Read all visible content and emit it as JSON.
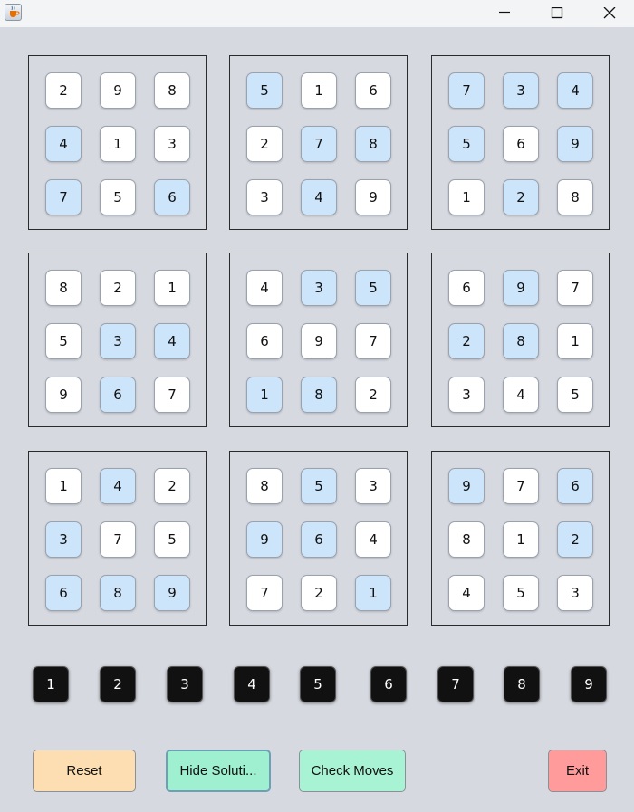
{
  "window": {
    "app_icon": "java-cup-icon",
    "controls": [
      "minimize-icon",
      "maximize-icon",
      "close-icon"
    ]
  },
  "board": {
    "boxes": [
      [
        {
          "v": "2",
          "c": "white"
        },
        {
          "v": "9",
          "c": "white"
        },
        {
          "v": "8",
          "c": "white"
        },
        {
          "v": "4",
          "c": "blue"
        },
        {
          "v": "1",
          "c": "white"
        },
        {
          "v": "3",
          "c": "white"
        },
        {
          "v": "7",
          "c": "blue"
        },
        {
          "v": "5",
          "c": "white"
        },
        {
          "v": "6",
          "c": "blue"
        }
      ],
      [
        {
          "v": "5",
          "c": "blue"
        },
        {
          "v": "1",
          "c": "white"
        },
        {
          "v": "6",
          "c": "white"
        },
        {
          "v": "2",
          "c": "white"
        },
        {
          "v": "7",
          "c": "blue"
        },
        {
          "v": "8",
          "c": "blue"
        },
        {
          "v": "3",
          "c": "white"
        },
        {
          "v": "4",
          "c": "blue"
        },
        {
          "v": "9",
          "c": "white"
        }
      ],
      [
        {
          "v": "7",
          "c": "blue"
        },
        {
          "v": "3",
          "c": "blue"
        },
        {
          "v": "4",
          "c": "blue"
        },
        {
          "v": "5",
          "c": "blue"
        },
        {
          "v": "6",
          "c": "white"
        },
        {
          "v": "9",
          "c": "blue"
        },
        {
          "v": "1",
          "c": "white"
        },
        {
          "v": "2",
          "c": "blue"
        },
        {
          "v": "8",
          "c": "white"
        }
      ],
      [
        {
          "v": "8",
          "c": "white"
        },
        {
          "v": "2",
          "c": "white"
        },
        {
          "v": "1",
          "c": "white"
        },
        {
          "v": "5",
          "c": "white"
        },
        {
          "v": "3",
          "c": "blue"
        },
        {
          "v": "4",
          "c": "blue"
        },
        {
          "v": "9",
          "c": "white"
        },
        {
          "v": "6",
          "c": "blue"
        },
        {
          "v": "7",
          "c": "white"
        }
      ],
      [
        {
          "v": "4",
          "c": "white"
        },
        {
          "v": "3",
          "c": "blue"
        },
        {
          "v": "5",
          "c": "blue"
        },
        {
          "v": "6",
          "c": "white"
        },
        {
          "v": "9",
          "c": "white"
        },
        {
          "v": "7",
          "c": "white"
        },
        {
          "v": "1",
          "c": "blue"
        },
        {
          "v": "8",
          "c": "blue"
        },
        {
          "v": "2",
          "c": "white"
        }
      ],
      [
        {
          "v": "6",
          "c": "white"
        },
        {
          "v": "9",
          "c": "blue"
        },
        {
          "v": "7",
          "c": "white"
        },
        {
          "v": "2",
          "c": "blue"
        },
        {
          "v": "8",
          "c": "blue"
        },
        {
          "v": "1",
          "c": "white"
        },
        {
          "v": "3",
          "c": "white"
        },
        {
          "v": "4",
          "c": "white"
        },
        {
          "v": "5",
          "c": "white"
        }
      ],
      [
        {
          "v": "1",
          "c": "white"
        },
        {
          "v": "4",
          "c": "blue"
        },
        {
          "v": "2",
          "c": "white"
        },
        {
          "v": "3",
          "c": "blue"
        },
        {
          "v": "7",
          "c": "white"
        },
        {
          "v": "5",
          "c": "white"
        },
        {
          "v": "6",
          "c": "blue"
        },
        {
          "v": "8",
          "c": "blue"
        },
        {
          "v": "9",
          "c": "blue"
        }
      ],
      [
        {
          "v": "8",
          "c": "white"
        },
        {
          "v": "5",
          "c": "blue"
        },
        {
          "v": "3",
          "c": "white"
        },
        {
          "v": "9",
          "c": "blue"
        },
        {
          "v": "6",
          "c": "blue"
        },
        {
          "v": "4",
          "c": "white"
        },
        {
          "v": "7",
          "c": "white"
        },
        {
          "v": "2",
          "c": "white"
        },
        {
          "v": "1",
          "c": "blue"
        }
      ],
      [
        {
          "v": "9",
          "c": "blue"
        },
        {
          "v": "7",
          "c": "white"
        },
        {
          "v": "6",
          "c": "blue"
        },
        {
          "v": "8",
          "c": "white"
        },
        {
          "v": "1",
          "c": "white"
        },
        {
          "v": "2",
          "c": "blue"
        },
        {
          "v": "4",
          "c": "white"
        },
        {
          "v": "5",
          "c": "white"
        },
        {
          "v": "3",
          "c": "white"
        }
      ]
    ]
  },
  "number_pad": [
    "1",
    "2",
    "3",
    "4",
    "5",
    "6",
    "7",
    "8",
    "9"
  ],
  "actions": {
    "reset_label": "Reset",
    "hide_solution_label": "Hide Soluti...",
    "check_moves_label": "Check Moves",
    "exit_label": "Exit"
  },
  "colors": {
    "background": "#d6d9e0",
    "given_cell": "#ffffff",
    "filled_cell": "#cce5fb",
    "number_key": "#111111",
    "reset": "#fddeb3",
    "hide_solution": "#9ef0d0",
    "check_moves": "#a8f3d4",
    "exit": "#ff9b9b"
  }
}
